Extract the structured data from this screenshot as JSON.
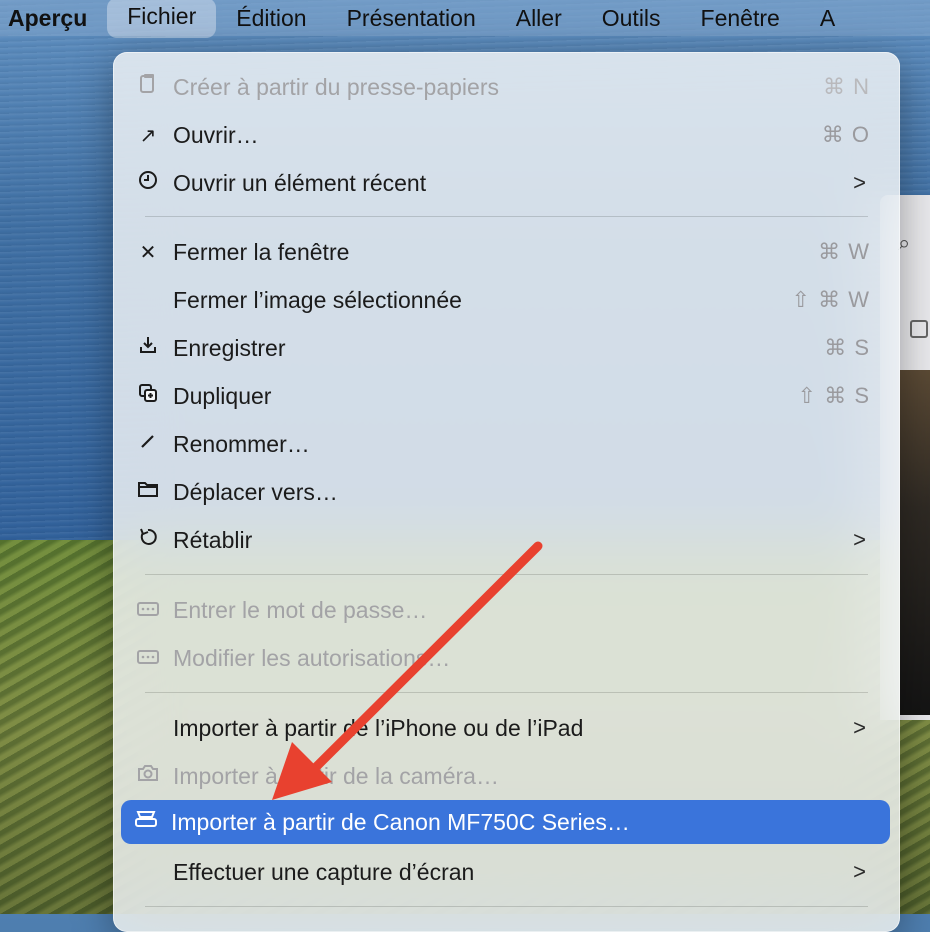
{
  "menubar": {
    "app": "Aperçu",
    "items": [
      "Fichier",
      "Édition",
      "Présentation",
      "Aller",
      "Outils",
      "Fenêtre",
      "A"
    ]
  },
  "menu": {
    "items": [
      {
        "label": "Créer à partir du presse-papiers",
        "shortcut": "⌘ N",
        "icon": "clipboard-icon",
        "disabled": true
      },
      {
        "label": "Ouvrir…",
        "shortcut": "⌘ O",
        "icon": "open-arrow-icon"
      },
      {
        "label": "Ouvrir un élément récent",
        "icon": "clock-icon",
        "submenu": true
      },
      {
        "label": "Fermer la fenêtre",
        "shortcut": "⌘ W",
        "icon": "close-icon"
      },
      {
        "label": "Fermer l’image sélectionnée",
        "shortcut": "⇧ ⌘ W"
      },
      {
        "label": "Enregistrer",
        "shortcut": "⌘ S",
        "icon": "save-icon"
      },
      {
        "label": "Dupliquer",
        "shortcut": "⇧ ⌘ S",
        "icon": "duplicate-icon"
      },
      {
        "label": "Renommer…",
        "icon": "pencil-icon"
      },
      {
        "label": "Déplacer vers…",
        "icon": "folder-icon"
      },
      {
        "label": "Rétablir",
        "icon": "revert-icon",
        "submenu": true
      },
      {
        "label": "Entrer le mot de passe…",
        "icon": "password-icon",
        "disabled": true
      },
      {
        "label": "Modifier les autorisations…",
        "icon": "password-icon",
        "disabled": true
      },
      {
        "label": "Importer à partir de l’iPhone ou de l’iPad",
        "submenu": true
      },
      {
        "label": "Importer à partir de la caméra…",
        "icon": "camera-icon",
        "disabled": true
      },
      {
        "label": "Importer à partir de Canon MF750C Series…",
        "icon": "scanner-icon",
        "highlighted": true
      },
      {
        "label": "Effectuer une capture d’écran",
        "submenu": true
      }
    ]
  },
  "chevron": ">"
}
